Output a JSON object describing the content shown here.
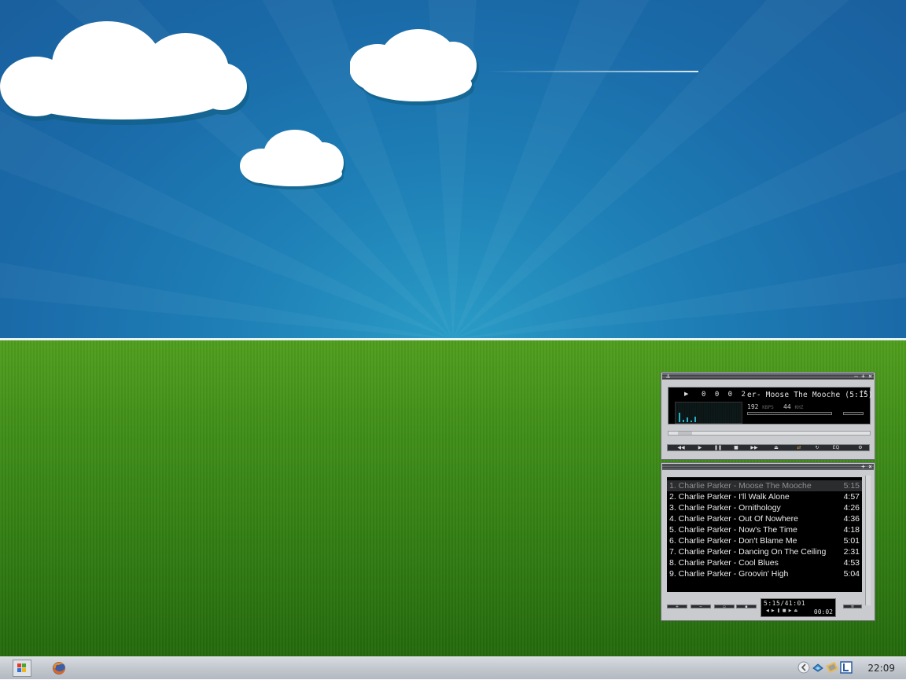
{
  "taskbar": {
    "start_icon": "windows-logo-icon",
    "pinned": [
      {
        "name": "Firefox",
        "icon": "firefox-icon"
      }
    ],
    "tray_icons": [
      "tray-expand-icon",
      "network-icon",
      "app-icon",
      "layout-icon"
    ],
    "clock": "22:09"
  },
  "player": {
    "title_buttons": [
      "–",
      "+",
      "×"
    ],
    "time_digits": "0 0  0 2",
    "song_title": "er- Moose The Mooche (5:15)",
    "scroll_marker": "**",
    "bitrate": "192",
    "bitrate_unit": "KBPS",
    "samplerate": "44",
    "samplerate_unit": "KHZ",
    "visualizer_levels": [
      0.55,
      0.15,
      0.25,
      0.1,
      0.3
    ],
    "seek_progress": 0.05
  },
  "playlist": {
    "title_buttons": [
      "+",
      "×"
    ],
    "tracks": [
      {
        "title": "1. Charlie Parker - Moose The Mooche",
        "length": "5:15",
        "current": true
      },
      {
        "title": "2. Charlie Parker - I'll Walk Alone",
        "length": "4:57"
      },
      {
        "title": "3. Charlie Parker - Ornithology",
        "length": "4:26"
      },
      {
        "title": "4. Charlie Parker - Out Of Nowhere",
        "length": "4:36"
      },
      {
        "title": "5. Charlie Parker - Now's The Time",
        "length": "4:18"
      },
      {
        "title": "6. Charlie Parker - Don't Blame Me",
        "length": "5:01"
      },
      {
        "title": "7. Charlie Parker - Dancing On The Ceiling",
        "length": "2:31"
      },
      {
        "title": "8. Charlie Parker - Cool Blues",
        "length": "4:53"
      },
      {
        "title": "9. Charlie Parker - Groovin' High",
        "length": "5:04"
      }
    ],
    "total_time": "5:15/41:01",
    "elapsed": "00:02"
  }
}
